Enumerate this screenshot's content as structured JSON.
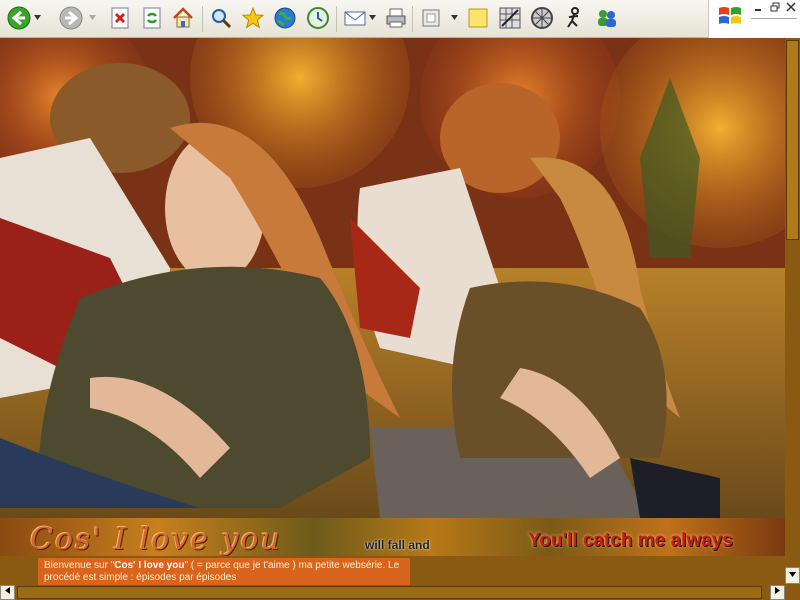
{
  "toolbar": {
    "icons": [
      "back-icon",
      "forward-icon",
      "stop-icon",
      "refresh-icon",
      "home-icon",
      "search-icon",
      "favorites-icon",
      "media-icon",
      "history-icon",
      "mail-icon",
      "print-icon",
      "edit-icon",
      "notes-icon",
      "messenger-icon",
      "research-icon",
      "msn-icon",
      "discuss-icon"
    ]
  },
  "banner": {
    "strip_left": "Cos' I love you",
    "strip_middle": "will fall and",
    "strip_right": "You'll catch me always"
  },
  "welcome": {
    "prefix": "Bienvenue sur \"",
    "bold": "Cos' I love you",
    "suffix": "\" ( = parce que je t'aime ) ma petite websérie. Le procédé est simple : épisodes par épisodes"
  },
  "colors": {
    "accent": "#d8641e",
    "tagline_red": "#c3221a",
    "frame_brown": "#8a5a12"
  }
}
